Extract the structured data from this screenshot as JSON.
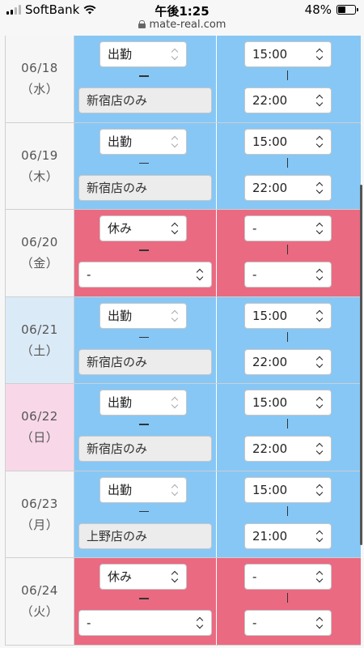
{
  "status_bar": {
    "carrier": "SoftBank",
    "time": "午後1:25",
    "battery": "48%",
    "battery_fraction": 0.48,
    "url": "mate-real.com"
  },
  "rows": [
    {
      "date": "06/18",
      "weekday": "（水）",
      "status": "出勤",
      "store": "新宿店のみ",
      "start": "15:00",
      "end": "22:00"
    },
    {
      "date": "06/19",
      "weekday": "（木）",
      "status": "出勤",
      "store": "新宿店のみ",
      "start": "15:00",
      "end": "22:00"
    },
    {
      "date": "06/20",
      "weekday": "（金）",
      "status": "休み",
      "store": "-",
      "start": "-",
      "end": "-"
    },
    {
      "date": "06/21",
      "weekday": "（土）",
      "status": "出勤",
      "store": "新宿店のみ",
      "start": "15:00",
      "end": "22:00"
    },
    {
      "date": "06/22",
      "weekday": "（日）",
      "status": "出勤",
      "store": "新宿店のみ",
      "start": "15:00",
      "end": "22:00"
    },
    {
      "date": "06/23",
      "weekday": "（月）",
      "status": "出勤",
      "store": "上野店のみ",
      "start": "15:00",
      "end": "21:00"
    },
    {
      "date": "06/24",
      "weekday": "（火）",
      "status": "休み",
      "store": "-",
      "start": "-",
      "end": "-"
    }
  ],
  "colors": {
    "work_bg": "#86c7f6",
    "off_bg": "#ea6a81",
    "saturday_bg": "#dbeaf7",
    "sunday_bg": "#f8d8e8"
  }
}
